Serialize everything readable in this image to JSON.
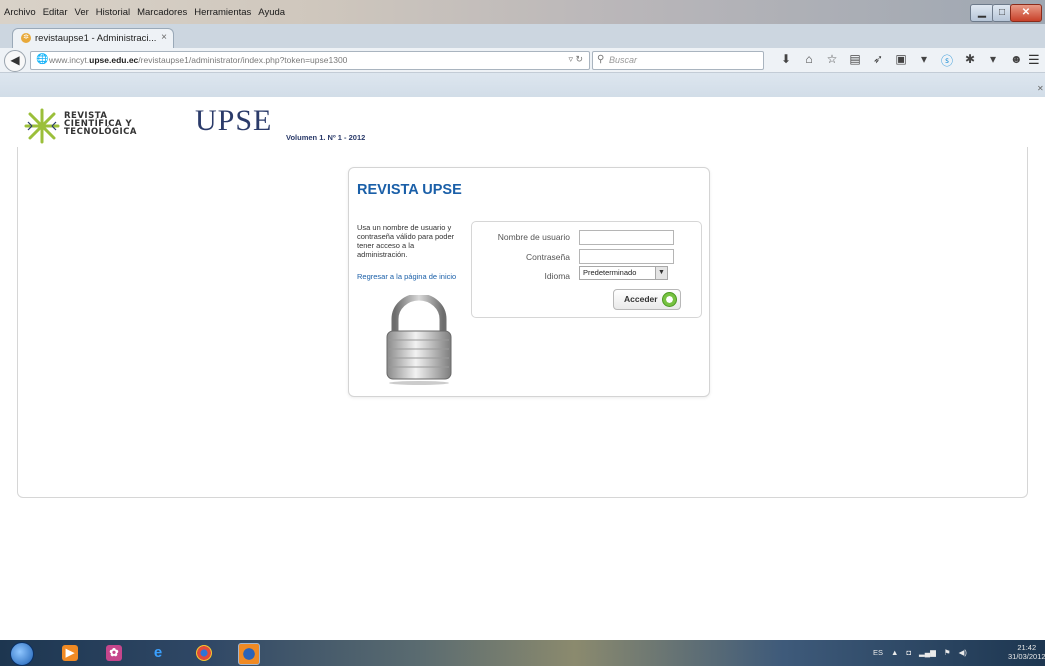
{
  "window": {
    "menu": [
      "Archivo",
      "Editar",
      "Ver",
      "Historial",
      "Marcadores",
      "Herramientas",
      "Ayuda"
    ]
  },
  "browser": {
    "tab_title": "revistaupse1 - Administraci...",
    "tab_close": "×",
    "new_tab": "+",
    "url_prefix": "www.incyt.",
    "url_domain": "upse.edu.ec",
    "url_suffix": "/revistaupse1/administrator/index.php?token=upse1300",
    "search_placeholder": "Buscar"
  },
  "header": {
    "logo_line1": "REVISTA",
    "logo_line2": "CIENTÍFICA Y",
    "logo_line3": "TECNOLÓGICA",
    "logo_upse": "UPSE",
    "volume": "Volumen 1. Nº 1 - 2012"
  },
  "login": {
    "title": "REVISTA UPSE",
    "help_text": "Usa un nombre de usuario y contraseña válido para poder tener acceso a la administración.",
    "back_link": "Regresar a la página de inicio",
    "username_label": "Nombre de usuario",
    "username_value": "",
    "password_label": "Contraseña",
    "password_value": "",
    "language_label": "Idioma",
    "language_selected": "Predeterminado",
    "submit_label": "Acceder"
  },
  "taskbar": {
    "lang": "ES",
    "time": "21:42",
    "date": "31/03/2012"
  }
}
